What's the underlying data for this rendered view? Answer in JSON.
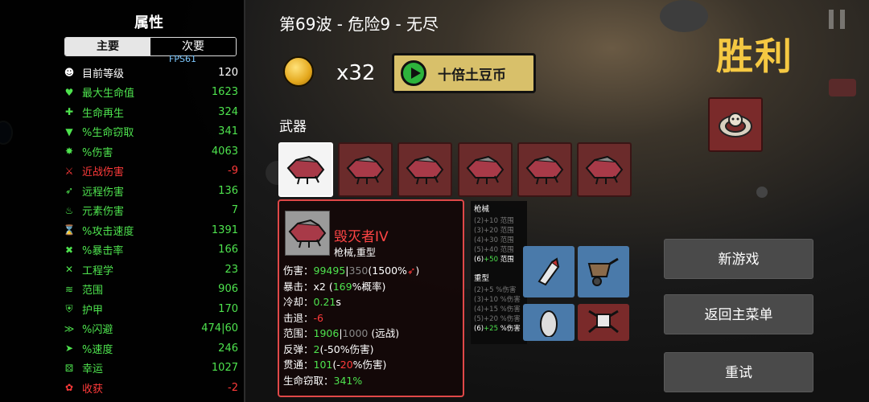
{
  "stats_panel": {
    "title": "属性",
    "tabs": [
      "主要",
      "次要"
    ],
    "fps": "FPS61",
    "rows": [
      {
        "icon": "level-icon",
        "glyph": "☻",
        "name": "目前等级",
        "value": "120",
        "name_color": "#ffffff",
        "value_color": "#ffffff"
      },
      {
        "icon": "heart-icon",
        "glyph": "♥",
        "name": "最大生命值",
        "value": "1623",
        "name_color": "#4ee34e",
        "value_color": "#4ee34e"
      },
      {
        "icon": "regen-icon",
        "glyph": "✚",
        "name": "生命再生",
        "value": "324",
        "name_color": "#4ee34e",
        "value_color": "#4ee34e"
      },
      {
        "icon": "lifesteal-icon",
        "glyph": "▼",
        "name": "%生命窃取",
        "value": "341",
        "name_color": "#4ee34e",
        "value_color": "#4ee34e"
      },
      {
        "icon": "damage-icon",
        "glyph": "✸",
        "name": "%伤害",
        "value": "4063",
        "name_color": "#4ee34e",
        "value_color": "#4ee34e"
      },
      {
        "icon": "melee-icon",
        "glyph": "⚔",
        "name": "近战伤害",
        "value": "-9",
        "name_color": "#ff3a3a",
        "value_color": "#ff3a3a"
      },
      {
        "icon": "ranged-icon",
        "glyph": "➶",
        "name": "远程伤害",
        "value": "136",
        "name_color": "#4ee34e",
        "value_color": "#4ee34e"
      },
      {
        "icon": "elemental-icon",
        "glyph": "♨",
        "name": "元素伤害",
        "value": "7",
        "name_color": "#4ee34e",
        "value_color": "#4ee34e"
      },
      {
        "icon": "attack-speed-icon",
        "glyph": "⌛",
        "name": "%攻击速度",
        "value": "1391",
        "name_color": "#4ee34e",
        "value_color": "#4ee34e"
      },
      {
        "icon": "crit-icon",
        "glyph": "✖",
        "name": "%暴击率",
        "value": "166",
        "name_color": "#4ee34e",
        "value_color": "#4ee34e"
      },
      {
        "icon": "engineering-icon",
        "glyph": "✕",
        "name": "工程学",
        "value": "23",
        "name_color": "#4ee34e",
        "value_color": "#4ee34e"
      },
      {
        "icon": "range-icon",
        "glyph": "≋",
        "name": "范围",
        "value": "906",
        "name_color": "#4ee34e",
        "value_color": "#4ee34e"
      },
      {
        "icon": "armor-icon",
        "glyph": "⛨",
        "name": "护甲",
        "value": "170",
        "name_color": "#4ee34e",
        "value_color": "#4ee34e"
      },
      {
        "icon": "dodge-icon",
        "glyph": "≫",
        "name": "%闪避",
        "value": "474|60",
        "name_color": "#4ee34e",
        "value_color": "#4ee34e"
      },
      {
        "icon": "speed-icon",
        "glyph": "➤",
        "name": "%速度",
        "value": "246",
        "name_color": "#4ee34e",
        "value_color": "#4ee34e"
      },
      {
        "icon": "luck-icon",
        "glyph": "⚄",
        "name": "幸运",
        "value": "1027",
        "name_color": "#4ee34e",
        "value_color": "#4ee34e"
      },
      {
        "icon": "harvest-icon",
        "glyph": "✿",
        "name": "收获",
        "value": "-2",
        "name_color": "#ff3a3a",
        "value_color": "#ff3a3a"
      }
    ]
  },
  "header": {
    "wave_text": "第69波 - 危险9 - 无尽",
    "victory": "胜利",
    "coin_count": "x32",
    "tenfold_button": "十倍土豆币"
  },
  "weapons": {
    "label": "武器",
    "slot_count": 6,
    "selected_index": 0
  },
  "tooltip": {
    "name": "毁灭者IV",
    "type": "枪械,重型",
    "lines": [
      {
        "parts": [
          [
            "伤害：",
            "w"
          ],
          [
            "99495",
            "g"
          ],
          [
            "|",
            "w"
          ],
          [
            "350",
            "d"
          ],
          [
            "(1500%",
            "w"
          ],
          [
            "➶",
            "r"
          ],
          [
            ")",
            "w"
          ]
        ]
      },
      {
        "parts": [
          [
            "暴击：x2 (",
            "w"
          ],
          [
            "169",
            "g"
          ],
          [
            "%概率)",
            "w"
          ]
        ]
      },
      {
        "parts": [
          [
            "冷却：",
            "w"
          ],
          [
            "0.21",
            "g"
          ],
          [
            "s",
            "w"
          ]
        ]
      },
      {
        "parts": [
          [
            "击退：",
            "w"
          ],
          [
            "-6",
            "r"
          ]
        ]
      },
      {
        "parts": [
          [
            "范围：",
            "w"
          ],
          [
            "1906",
            "g"
          ],
          [
            "|",
            "w"
          ],
          [
            "1000",
            "d"
          ],
          [
            " (远战)",
            "w"
          ]
        ]
      },
      {
        "parts": [
          [
            "反弹：",
            "w"
          ],
          [
            "2",
            "g"
          ],
          [
            "(-50%伤害)",
            "w"
          ]
        ]
      },
      {
        "parts": [
          [
            "贯通：",
            "w"
          ],
          [
            "101",
            "g"
          ],
          [
            "(-",
            "w"
          ],
          [
            "20",
            "r"
          ],
          [
            "%伤害)",
            "w"
          ]
        ]
      },
      {
        "parts": [
          [
            "生命窃取：",
            "w"
          ],
          [
            "341%",
            "g"
          ]
        ]
      }
    ]
  },
  "set_bonuses": {
    "groups": [
      {
        "title": "枪械",
        "lines": [
          {
            "text": "(2)+10 范围",
            "active": false
          },
          {
            "text": "(3)+20 范围",
            "active": false
          },
          {
            "text": "(4)+30 范围",
            "active": false
          },
          {
            "text": "(5)+40 范围",
            "active": false
          },
          {
            "prefix": "(6)",
            "value": "+50",
            "suffix": " 范围",
            "active": true
          }
        ]
      },
      {
        "title": "重型",
        "lines": [
          {
            "text": "(2)+5 %伤害",
            "active": false
          },
          {
            "text": "(3)+10 %伤害",
            "active": false
          },
          {
            "text": "(4)+15 %伤害",
            "active": false
          },
          {
            "text": "(5)+20 %伤害",
            "active": false
          },
          {
            "prefix": "(6)",
            "value": "+25",
            "suffix": " %伤害",
            "active": true
          }
        ]
      }
    ]
  },
  "menu": {
    "new_game": "新游戏",
    "main_menu": "返回主菜单",
    "retry": "重试"
  },
  "colors": {
    "green": "#4ee34e",
    "red": "#ff3a3a",
    "victory_gold": "#f5c842",
    "weapon_slot": "#6b2b2b",
    "tooltip_border": "#e04848"
  }
}
